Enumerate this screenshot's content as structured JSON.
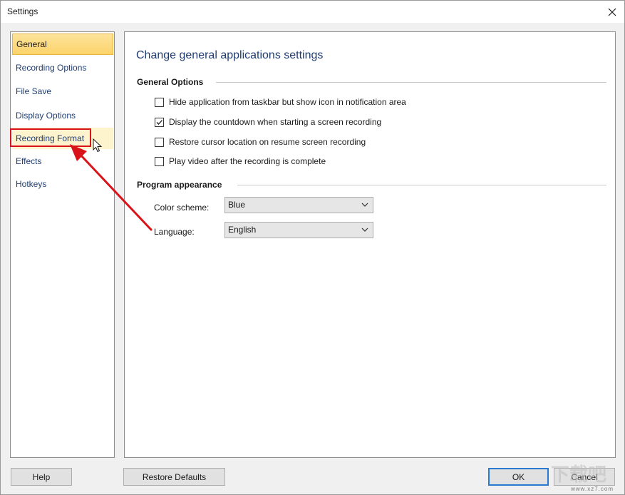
{
  "window": {
    "title": "Settings"
  },
  "nav": {
    "items": [
      {
        "label": "General",
        "state": "active"
      },
      {
        "label": "Recording Options",
        "state": "normal"
      },
      {
        "label": "File Save",
        "state": "normal"
      },
      {
        "label": "Display Options",
        "state": "normal"
      },
      {
        "label": "Recording Format",
        "state": "hover"
      },
      {
        "label": "Effects",
        "state": "normal"
      },
      {
        "label": "Hotkeys",
        "state": "normal"
      }
    ]
  },
  "main": {
    "heading": "Change general applications settings",
    "general_options": {
      "title": "General Options",
      "options": [
        {
          "label": "Hide application from taskbar but show icon in notification area",
          "checked": false
        },
        {
          "label": "Display the countdown when starting a screen recording",
          "checked": true
        },
        {
          "label": "Restore cursor location on resume screen recording",
          "checked": false
        },
        {
          "label": "Play video after the recording is complete",
          "checked": false
        }
      ]
    },
    "appearance": {
      "title": "Program appearance",
      "color_scheme_label": "Color scheme:",
      "color_scheme_value": "Blue",
      "language_label": "Language:",
      "language_value": "English"
    }
  },
  "footer": {
    "help": "Help",
    "restore_defaults": "Restore Defaults",
    "ok": "OK",
    "cancel": "Cancel"
  },
  "annotation": {
    "color": "#d9131a"
  },
  "watermark": {
    "text": "www.xz7.com"
  },
  "icons": [
    "close-icon",
    "checkmark-icon",
    "chevron-down-icon",
    "mouse-cursor-icon",
    "annotation-arrow-icon"
  ]
}
